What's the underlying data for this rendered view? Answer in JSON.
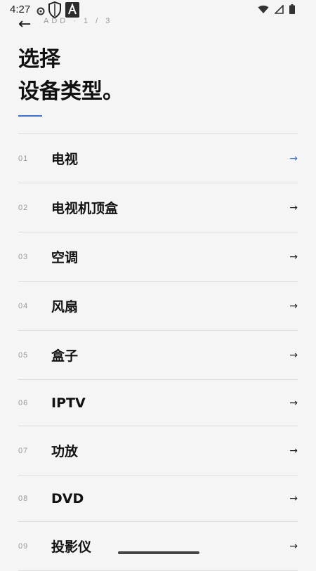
{
  "status_bar": {
    "time": "4:27"
  },
  "header": {
    "back_glyph": "←",
    "step_label": "ADD · 1 / 3",
    "title_line1": "选择",
    "title_line2": "设备类型。"
  },
  "device_types": [
    {
      "num": "01",
      "label": "电视"
    },
    {
      "num": "02",
      "label": "电视机顶盒"
    },
    {
      "num": "03",
      "label": "空调"
    },
    {
      "num": "04",
      "label": "风扇"
    },
    {
      "num": "05",
      "label": "盒子"
    },
    {
      "num": "06",
      "label": "IPTV"
    },
    {
      "num": "07",
      "label": "功放"
    },
    {
      "num": "08",
      "label": "DVD"
    },
    {
      "num": "09",
      "label": "投影仪"
    }
  ],
  "arrow_glyph": "→",
  "colors": {
    "accent": "#3b6fd0",
    "background": "#f5f5f5",
    "divider": "#dedede",
    "muted_text": "#9a9a9a"
  },
  "icons": {
    "status_left": [
      "gear-notification-icon",
      "shield-icon",
      "translate-a-icon"
    ],
    "status_right": [
      "wifi-icon",
      "signal-icon",
      "battery-icon"
    ]
  }
}
